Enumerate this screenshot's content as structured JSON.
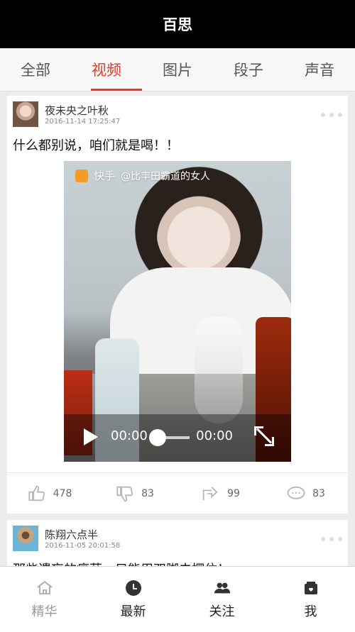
{
  "title": "百思",
  "tabs": [
    "全部",
    "视频",
    "图片",
    "段子",
    "声音"
  ],
  "post1": {
    "username": "夜未央之叶秋",
    "timestamp": "2016-11-14 17:25:47",
    "text": "什么都别说，咱们就是喝！！",
    "video": {
      "watermark_app": "快手",
      "watermark_handle": "@比丰田霸道的女人",
      "time_start": "00:00",
      "time_end": "00:00",
      "progress": 0.0
    },
    "actions": [
      "478",
      "83",
      "99",
      "83"
    ]
  },
  "post2": {
    "username": "陈翔六点半",
    "timestamp": "2016-11-05 20:01:58",
    "text": "那些遗忘的瘙草，只能用双脚去摆住！"
  },
  "bottom_nav": [
    "精华",
    "最新",
    "关注",
    "我"
  ],
  "colors": {
    "accent": "#e53a2b",
    "header": "#000000"
  }
}
